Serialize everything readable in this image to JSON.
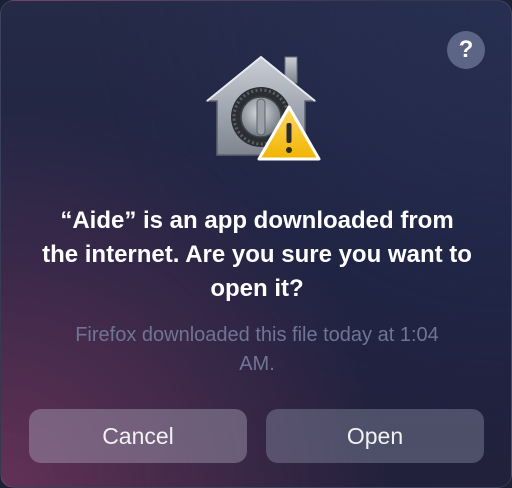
{
  "dialog": {
    "help_label": "?",
    "title": "“Aide” is an app downloaded from the internet. Are you sure you want to open it?",
    "subtitle": "Firefox downloaded this file today at 1:04 AM.",
    "cancel_label": "Cancel",
    "open_label": "Open"
  },
  "icons": {
    "app": "gatekeeper-vault-icon",
    "warning": "warning-triangle-icon",
    "help": "help-icon"
  }
}
